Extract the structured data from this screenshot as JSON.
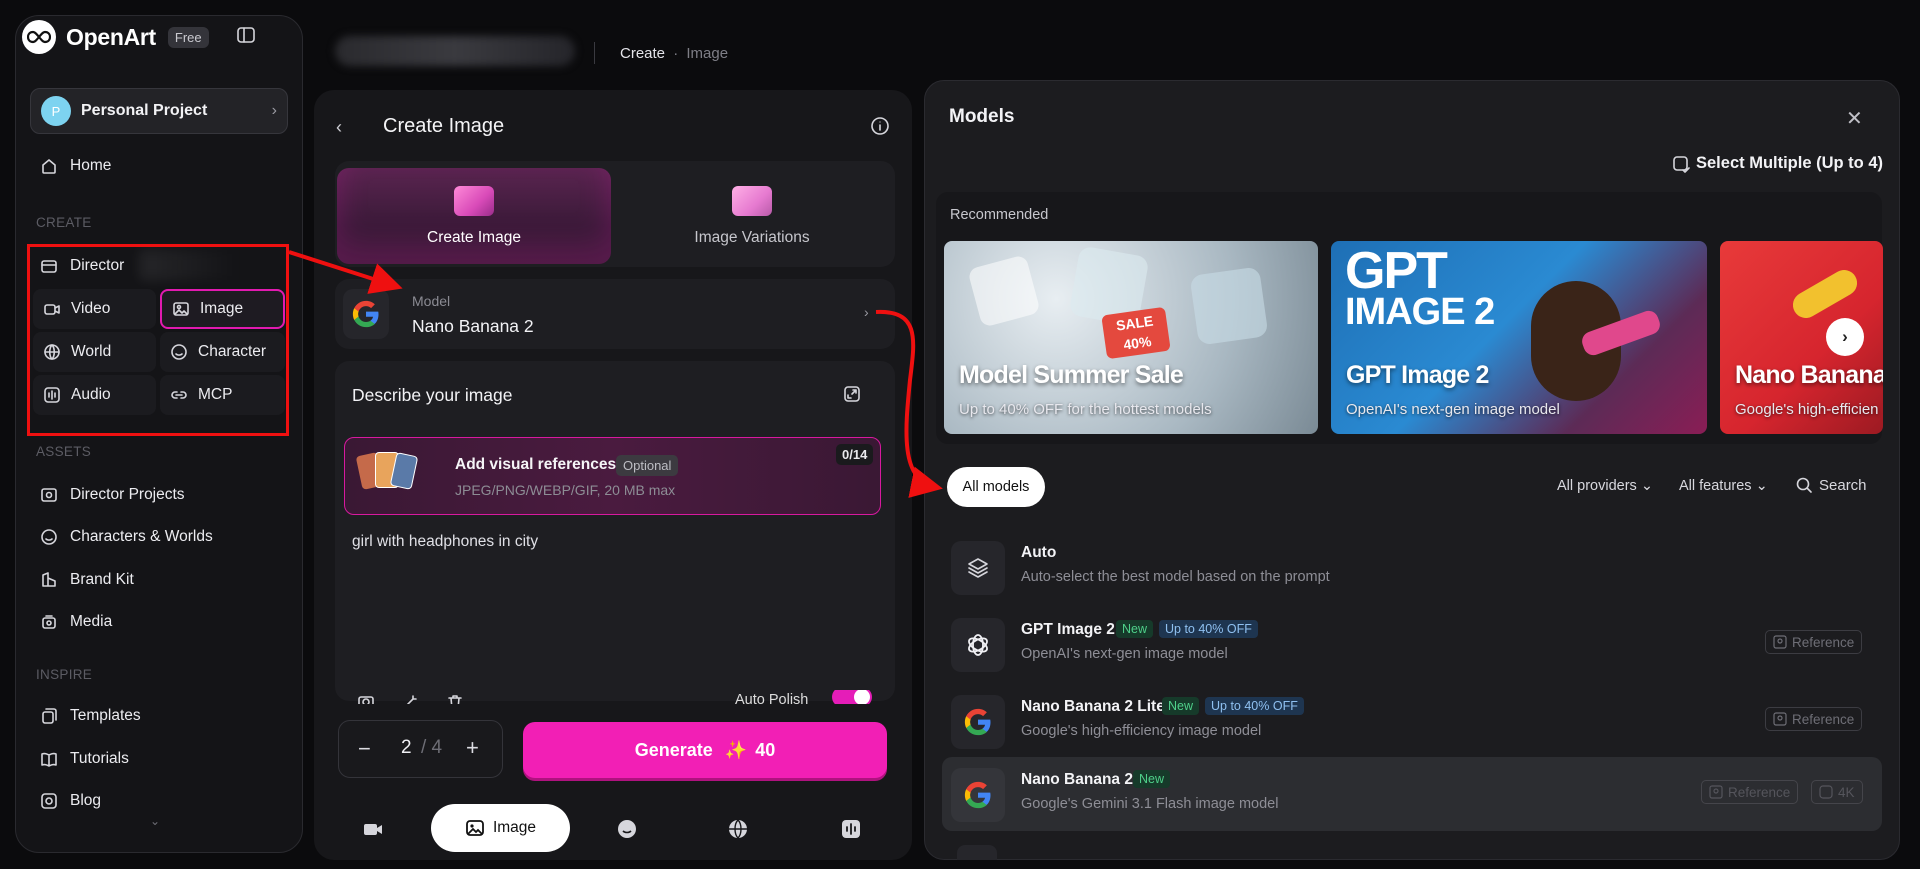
{
  "app": {
    "name": "OpenArt",
    "plan": "Free"
  },
  "project": {
    "avatar": "P",
    "name": "Personal Project"
  },
  "nav": {
    "home": "Home",
    "create_header": "CREATE",
    "director": "Director",
    "grid": [
      "Video",
      "Image",
      "World",
      "Character",
      "Audio",
      "MCP"
    ],
    "assets_header": "ASSETS",
    "assets": [
      "Director Projects",
      "Characters & Worlds",
      "Brand Kit",
      "Media"
    ],
    "inspire_header": "INSPIRE",
    "inspire": [
      "Templates",
      "Tutorials",
      "Blog"
    ]
  },
  "breadcrumb": {
    "current": "Create",
    "sep": "·",
    "sub": "Image"
  },
  "create": {
    "title": "Create Image",
    "tabs": [
      "Create Image",
      "Image Variations"
    ],
    "model_label": "Model",
    "model_value": "Nano Banana 2",
    "describe_title": "Describe your image",
    "ref_title": "Add visual references",
    "ref_optional": "Optional",
    "ref_formats": "JPEG/PNG/WEBP/GIF, 20 MB max",
    "ref_count": "0/14",
    "prompt": "girl with headphones in city",
    "auto_polish": "Auto Polish",
    "count_value": "2",
    "count_max": "/ 4",
    "generate_label": "Generate",
    "generate_cost": "40",
    "bottom_active": "Image"
  },
  "models_panel": {
    "title": "Models",
    "select_multiple": "Select Multiple (Up to 4)",
    "recommended_label": "Recommended",
    "cards": [
      {
        "title": "Model Summer Sale",
        "subtitle": "Up to 40% OFF for the hottest models"
      },
      {
        "title": "GPT Image 2",
        "subtitle": "OpenAI's next-gen image model",
        "art_text_1": "GPT",
        "art_text_2": "IMAGE 2"
      },
      {
        "title": "Nano Banana",
        "subtitle": "Google's high-efficien"
      }
    ],
    "sale_tag": "SALE 40%",
    "filter_all": "All models",
    "providers": "All providers",
    "features": "All features",
    "search": "Search",
    "rows": [
      {
        "name": "Auto",
        "desc": "Auto-select the best model based on the prompt",
        "icon": "layers-icon"
      },
      {
        "name": "GPT Image 2",
        "badge_new": "New",
        "badge_off": "Up to 40% OFF",
        "desc": "OpenAI's next-gen image model",
        "reference": "Reference",
        "icon": "openai-icon"
      },
      {
        "name": "Nano Banana 2 Lite",
        "badge_new": "New",
        "badge_off": "Up to 40% OFF",
        "desc": "Google's high-efficiency image model",
        "reference": "Reference",
        "icon": "google-icon"
      },
      {
        "name": "Nano Banana 2",
        "badge_new": "New",
        "desc": "Google's Gemini 3.1 Flash image model",
        "reference": "Reference",
        "res": "4K",
        "icon": "google-icon",
        "selected": true
      }
    ]
  },
  "colors": {
    "accent": "#f21fb5",
    "annotation": "#ef1010"
  }
}
